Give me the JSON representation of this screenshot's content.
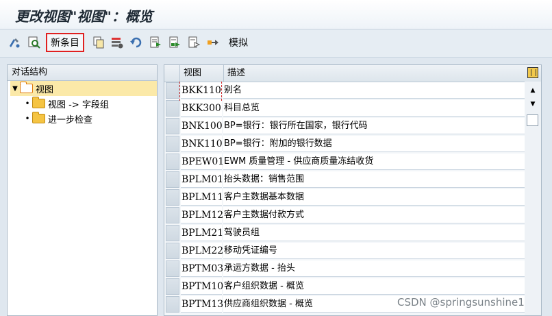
{
  "window": {
    "title": "更改视图\"视图\"：概览"
  },
  "toolbar": {
    "new_entries": "新条目",
    "simulate": "模拟",
    "icons": [
      "display-change-icon",
      "find-icon",
      "copy-icon",
      "delete-icon",
      "undo-icon",
      "select-all-icon",
      "select-block-icon",
      "deselect-all-icon",
      "transport-icon"
    ]
  },
  "tree": {
    "header": "对话结构",
    "items": [
      {
        "label": "视图",
        "level": 0,
        "expanded": true,
        "selected": true
      },
      {
        "label": "视图 -> 字段组",
        "level": 1
      },
      {
        "label": "进一步检查",
        "level": 1
      }
    ]
  },
  "table": {
    "columns": [
      "视图",
      "描述"
    ],
    "rows": [
      {
        "view": "BKK110",
        "desc": "别名"
      },
      {
        "view": "BKK300",
        "desc": "科目总览"
      },
      {
        "view": "BNK100",
        "desc": "BP=银行：银行所在国家，银行代码"
      },
      {
        "view": "BNK110",
        "desc": "BP=银行：附加的银行数据"
      },
      {
        "view": "BPEW01",
        "desc": "EWM 质量管理 - 供应商质量冻结收货"
      },
      {
        "view": "BPLM01",
        "desc": "抬头数据：销售范围"
      },
      {
        "view": "BPLM11",
        "desc": "客户主数据基本数据"
      },
      {
        "view": "BPLM12",
        "desc": "客户主数据付款方式"
      },
      {
        "view": "BPLM21",
        "desc": "驾驶员组"
      },
      {
        "view": "BPLM22",
        "desc": "移动凭证编号"
      },
      {
        "view": "BPTM03",
        "desc": "承运方数据 - 抬头"
      },
      {
        "view": "BPTM10",
        "desc": "客户组织数据 - 概览"
      },
      {
        "view": "BPTM13",
        "desc": "供应商组织数据 - 概览"
      }
    ]
  },
  "watermark": "CSDN @springsunshine1"
}
